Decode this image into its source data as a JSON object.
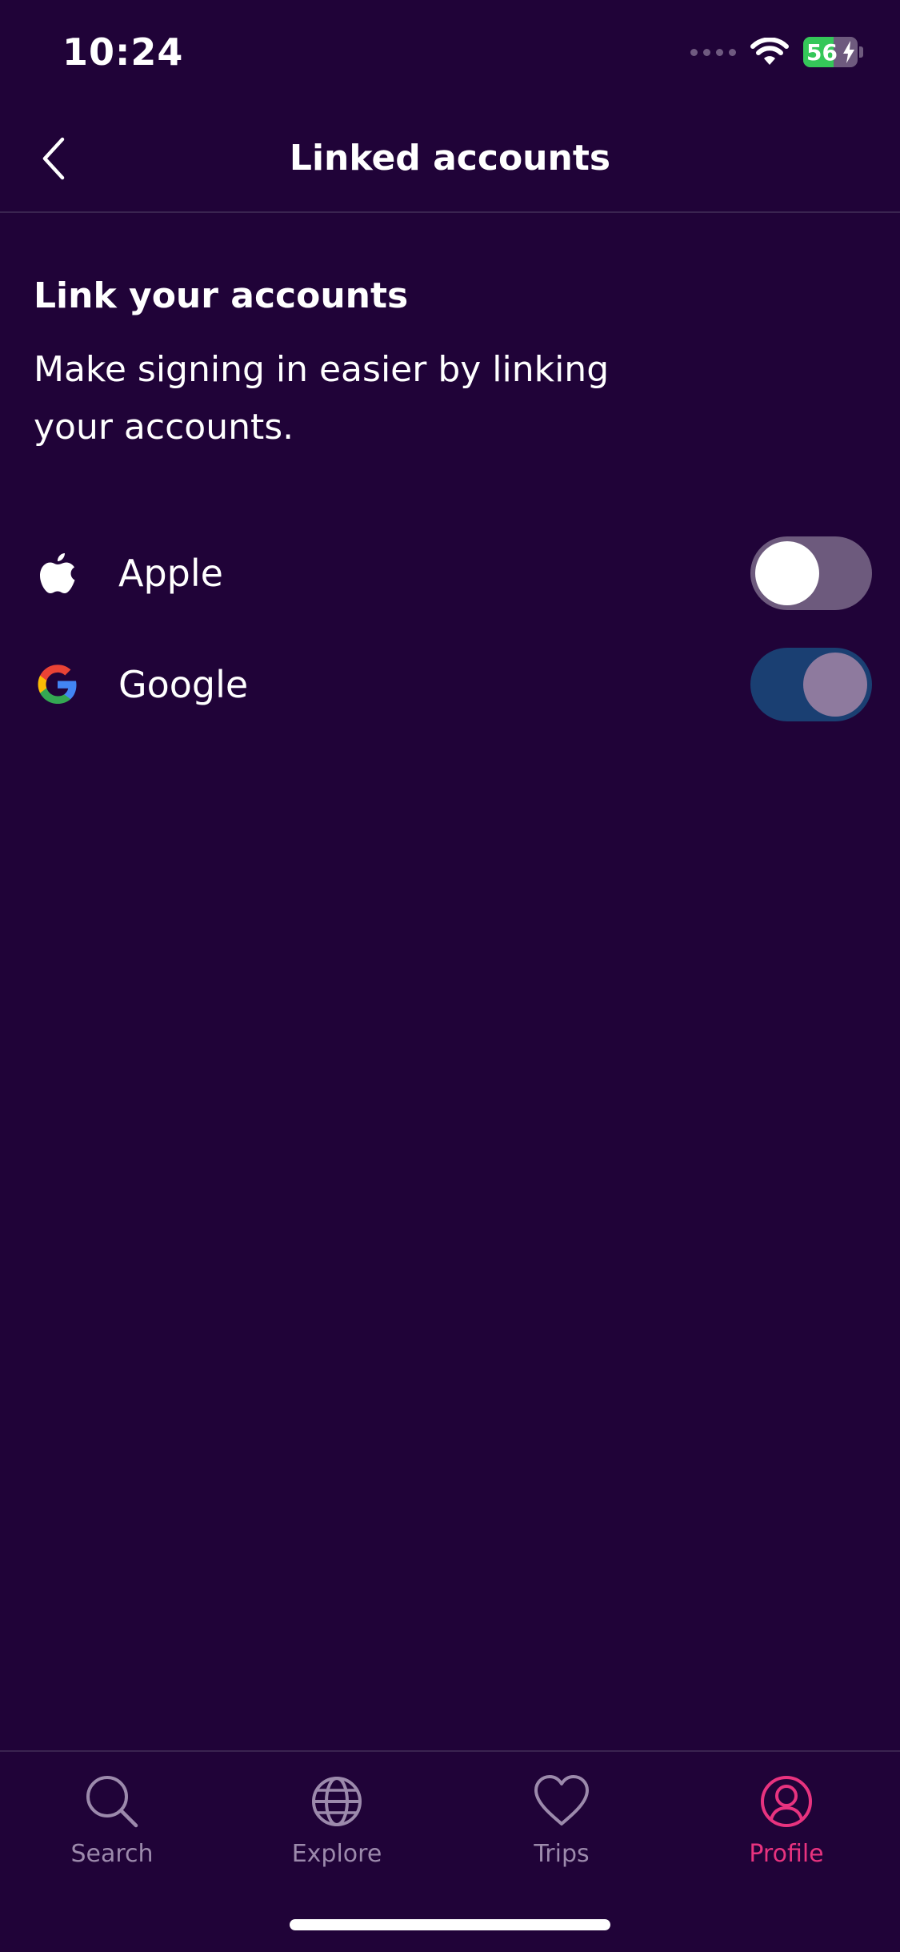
{
  "status_bar": {
    "time": "10:24",
    "battery_level": "56",
    "battery_percent": 56
  },
  "header": {
    "title": "Linked accounts"
  },
  "section": {
    "title": "Link your accounts",
    "description": "Make signing in easier by linking your accounts."
  },
  "accounts": [
    {
      "label": "Apple",
      "icon": "apple-icon",
      "linked": false
    },
    {
      "label": "Google",
      "icon": "google-icon",
      "linked": true
    }
  ],
  "tab_bar": {
    "tabs": [
      {
        "label": "Search",
        "icon": "search-icon",
        "active": false
      },
      {
        "label": "Explore",
        "icon": "globe-icon",
        "active": false
      },
      {
        "label": "Trips",
        "icon": "heart-icon",
        "active": false
      },
      {
        "label": "Profile",
        "icon": "profile-icon",
        "active": true
      }
    ]
  },
  "colors": {
    "background": "#200338",
    "accent": "#e8337f",
    "toggle_on": "#1a3f72",
    "toggle_off": "#6d5a7d",
    "tab_inactive": "#9c8aac"
  }
}
